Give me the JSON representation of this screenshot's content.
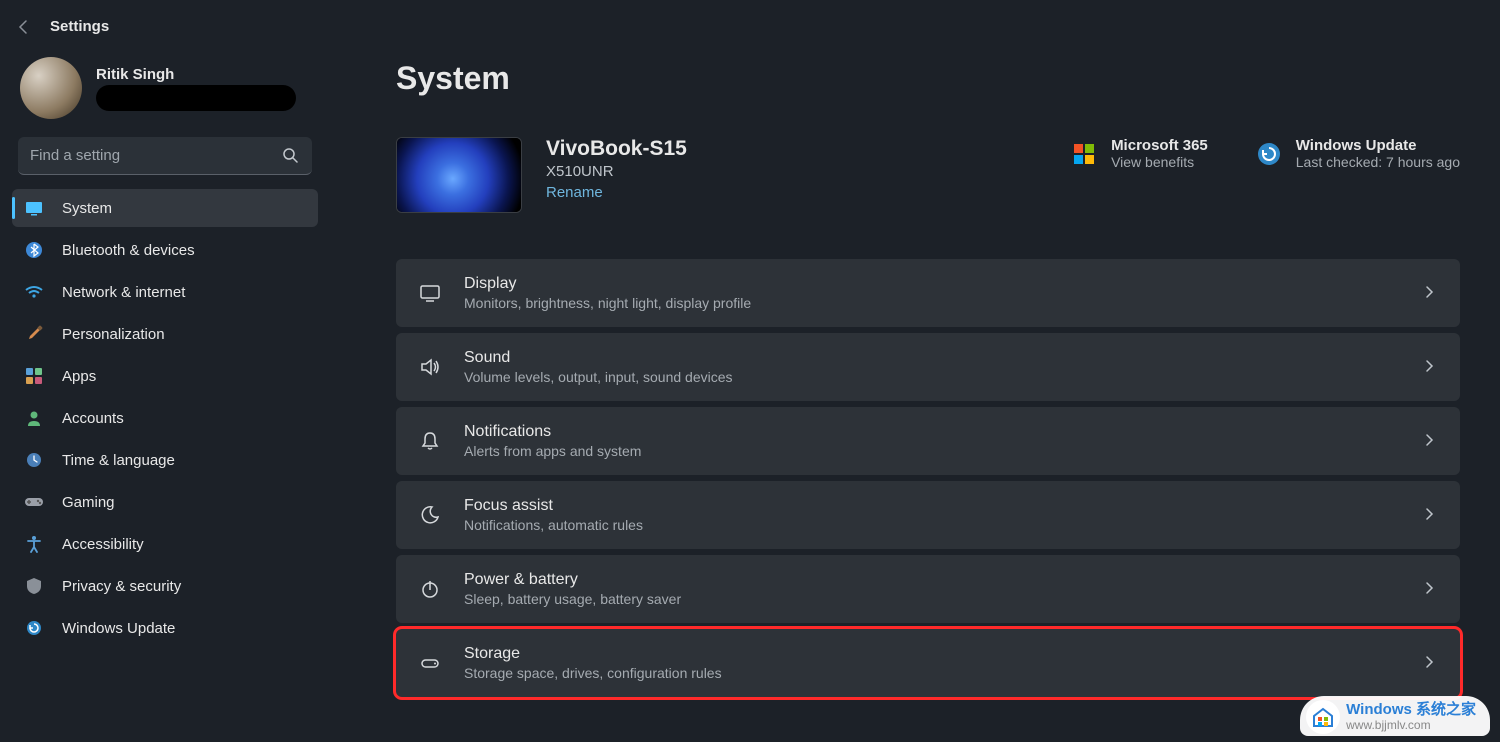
{
  "header": {
    "back": "←",
    "title": "Settings"
  },
  "profile": {
    "name": "Ritik Singh"
  },
  "search": {
    "placeholder": "Find a setting"
  },
  "nav": {
    "items": [
      {
        "label": "System",
        "selected": true
      },
      {
        "label": "Bluetooth & devices"
      },
      {
        "label": "Network & internet"
      },
      {
        "label": "Personalization"
      },
      {
        "label": "Apps"
      },
      {
        "label": "Accounts"
      },
      {
        "label": "Time & language"
      },
      {
        "label": "Gaming"
      },
      {
        "label": "Accessibility"
      },
      {
        "label": "Privacy & security"
      },
      {
        "label": "Windows Update"
      }
    ]
  },
  "page": {
    "title": "System"
  },
  "device": {
    "name": "VivoBook-S15",
    "model": "X510UNR",
    "rename": "Rename"
  },
  "headerRight": {
    "m365": {
      "title": "Microsoft 365",
      "sub": "View benefits"
    },
    "update": {
      "title": "Windows Update",
      "sub": "Last checked: 7 hours ago"
    }
  },
  "cards": [
    {
      "title": "Display",
      "sub": "Monitors, brightness, night light, display profile"
    },
    {
      "title": "Sound",
      "sub": "Volume levels, output, input, sound devices"
    },
    {
      "title": "Notifications",
      "sub": "Alerts from apps and system"
    },
    {
      "title": "Focus assist",
      "sub": "Notifications, automatic rules"
    },
    {
      "title": "Power & battery",
      "sub": "Sleep, battery usage, battery saver"
    },
    {
      "title": "Storage",
      "sub": "Storage space, drives, configuration rules",
      "highlighted": true
    }
  ],
  "watermark": {
    "title": "Windows 系统之家",
    "sub": "www.bjjmlv.com"
  }
}
